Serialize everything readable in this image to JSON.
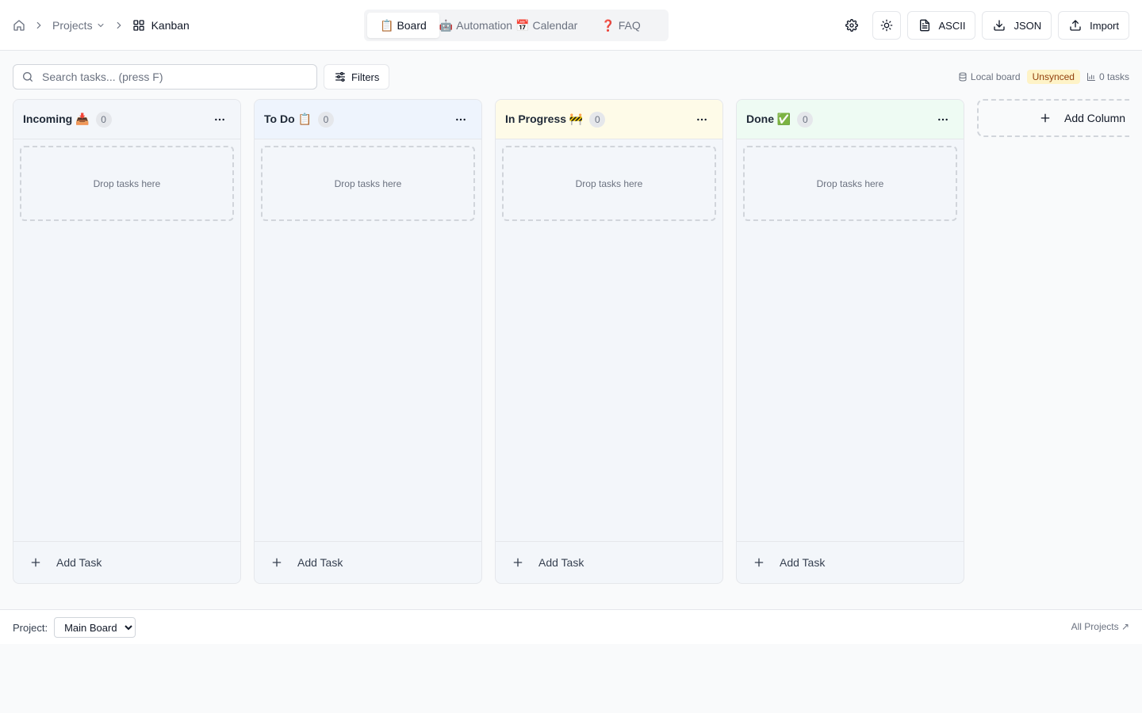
{
  "colors": {
    "accent": "#111827",
    "muted": "#6b7280",
    "border": "#e5e7eb",
    "unsynced_bg": "#fef3c7",
    "unsynced_fg": "#92400e"
  },
  "breadcrumb": {
    "home_icon": "home-icon",
    "projects": "Projects",
    "current": "Kanban",
    "current_icon": "grid-icon"
  },
  "tabs": [
    {
      "emoji": "📋",
      "label": "Board",
      "active": true
    },
    {
      "emoji": "🤖",
      "label": "Automation",
      "active": false
    },
    {
      "emoji": "📅",
      "label": "Calendar",
      "active": false
    },
    {
      "emoji": "❓",
      "label": "FAQ",
      "active": false
    }
  ],
  "actions": {
    "settings_icon": "gear-icon",
    "theme_icon": "sun-icon",
    "ascii": "ASCII",
    "json": "JSON",
    "import": "Import"
  },
  "search": {
    "placeholder": "Search tasks... (press F)",
    "value": ""
  },
  "filters": {
    "label": "Filters"
  },
  "status": {
    "storage": "Local board",
    "sync": "Unsynced",
    "count": "0 tasks"
  },
  "columns": [
    {
      "title": "Incoming 📥",
      "count": "0",
      "drop_label": "Drop tasks here",
      "add_label": "Add Task",
      "color": "#f3f6fa"
    },
    {
      "title": "To Do 📋",
      "count": "0",
      "drop_label": "Drop tasks here",
      "add_label": "Add Task",
      "color": "#eef4fd"
    },
    {
      "title": "In Progress 🚧",
      "count": "0",
      "drop_label": "Drop tasks here",
      "add_label": "Add Task",
      "color": "#fefbe8"
    },
    {
      "title": "Done ✅",
      "count": "0",
      "drop_label": "Drop tasks here",
      "add_label": "Add Task",
      "color": "#eefbf3"
    }
  ],
  "add_column": {
    "label": "Add Column"
  },
  "footer": {
    "project_label": "Project:",
    "project_selected": "Main Board",
    "all_projects": "All Projects ↗"
  }
}
